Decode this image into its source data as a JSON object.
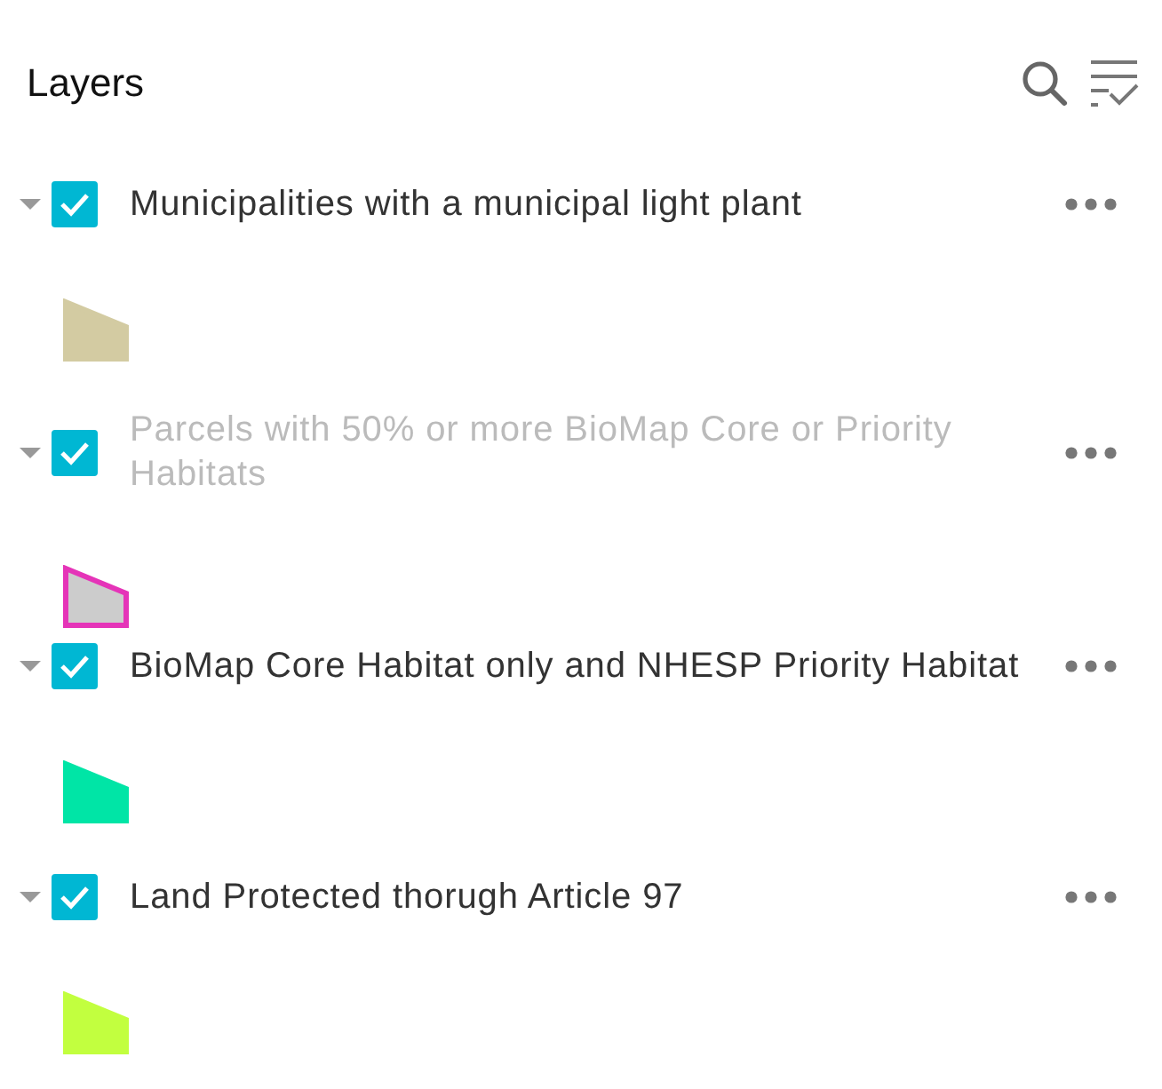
{
  "panel": {
    "title": "Layers"
  },
  "layers": [
    {
      "title": "Municipalities with a municipal light plant",
      "expanded": true,
      "checked": true,
      "disabled": false,
      "swatch": {
        "fill": {
          "color": "#d3cba2"
        },
        "outline": {
          "color": "#d3cba2"
        }
      }
    },
    {
      "title": "Parcels with 50% or more BioMap Core or Priority Habitats",
      "expanded": true,
      "checked": true,
      "disabled": true,
      "swatch": {
        "fill": {
          "color": "#cccccc"
        },
        "outline": {
          "color": "#e534b8"
        }
      }
    },
    {
      "title": "BioMap Core Habitat only and NHESP Priority Habitat",
      "expanded": true,
      "checked": true,
      "disabled": false,
      "swatch": {
        "fill": {
          "color": "#00e5a6"
        },
        "outline": {
          "color": "#00e5a6"
        }
      }
    },
    {
      "title": "Land Protected thorugh Article 97",
      "expanded": true,
      "checked": true,
      "disabled": false,
      "swatch": {
        "fill": {
          "color": "#c2ff3f"
        },
        "outline": {
          "color": "#c2ff3f"
        }
      }
    }
  ]
}
